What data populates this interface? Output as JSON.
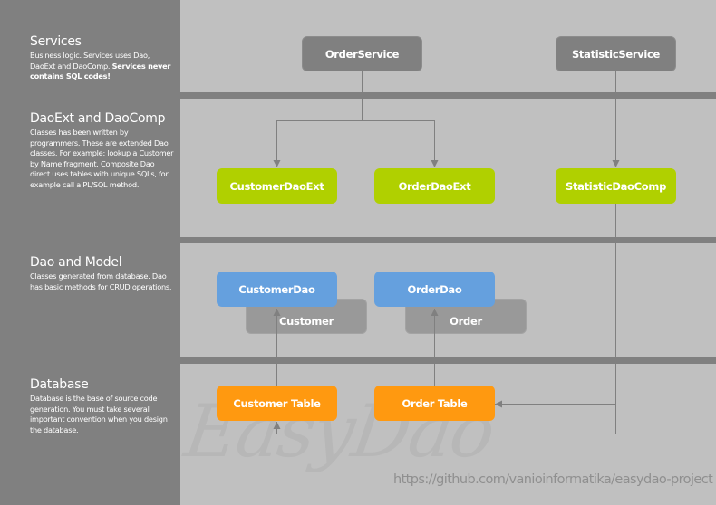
{
  "layers": [
    {
      "title": "Services",
      "description_parts": [
        {
          "text": "Business logic. Services uses Dao, DaoExt and DaoComp. ",
          "bold": false
        },
        {
          "text": "Services never contains SQL codes!",
          "bold": true
        }
      ]
    },
    {
      "title": "DaoExt and DaoComp",
      "description_parts": [
        {
          "text": "Classes has been written by programmers. These are extended Dao classes. For example: lookup a Customer by Name fragment. Composite Dao direct uses tables with unique SQLs, for example call a PL/SQL method.",
          "bold": false
        }
      ]
    },
    {
      "title": "Dao and Model",
      "description_parts": [
        {
          "text": "Classes generated from database. Dao has basic methods for CRUD operations.",
          "bold": false
        }
      ]
    },
    {
      "title": "Database",
      "description_parts": [
        {
          "text": "Database is the base of source code generation. You must take several important convention when you design the database.",
          "bold": false
        }
      ]
    }
  ],
  "nodes": {
    "order_service": "OrderService",
    "statistic_service": "StatisticService",
    "customer_dao_ext": "CustomerDaoExt",
    "order_dao_ext": "OrderDaoExt",
    "statistic_dao_comp": "StatisticDaoComp",
    "customer_dao": "CustomerDao",
    "order_dao": "OrderDao",
    "customer_model": "Customer",
    "order_model": "Order",
    "customer_table": "Customer Table",
    "order_table": "Order Table"
  },
  "edges": [
    {
      "from": "OrderService",
      "to": "CustomerDaoExt"
    },
    {
      "from": "OrderService",
      "to": "OrderDaoExt"
    },
    {
      "from": "StatisticService",
      "to": "StatisticDaoComp"
    },
    {
      "from": "CustomerDaoExt",
      "to": "CustomerDao"
    },
    {
      "from": "OrderDaoExt",
      "to": "OrderDao"
    },
    {
      "from": "StatisticDaoComp",
      "to": "Order Table"
    },
    {
      "from": "StatisticDaoComp",
      "to": "Customer Table"
    }
  ],
  "colors": {
    "panel": "#808080",
    "background": "#c0c0c0",
    "service": "#808080",
    "ext": "#b0d000",
    "dao": "#65a0de",
    "model": "#999999",
    "table": "#ff9910",
    "connector": "#808080"
  },
  "watermark": "EasyDao",
  "url": "https://github.com/vanioinformatika/easydao-project"
}
